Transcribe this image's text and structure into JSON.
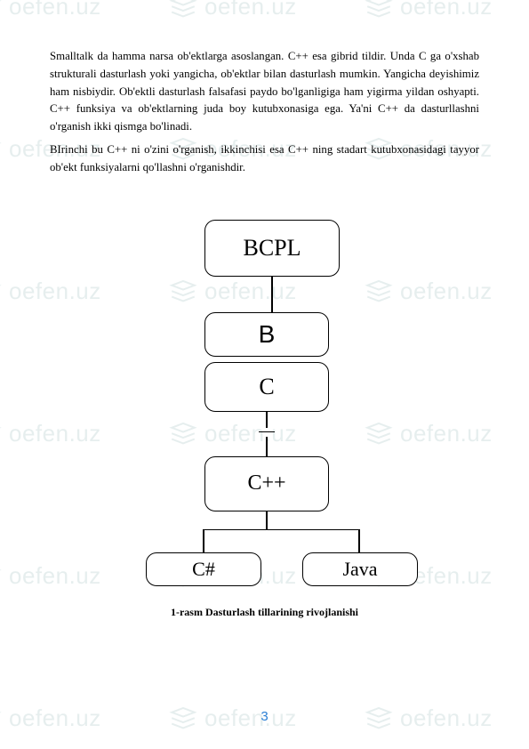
{
  "watermark": {
    "text": "oefen.uz"
  },
  "paragraphs": {
    "p1": "Smalltalk da hamma narsa ob'ektlarga asoslangan. C++ esa gibrid tildir. Unda C ga o'xshab strukturali dasturlash yoki yangicha, ob'ektlar bilan dasturlash mumkin. Yangicha deyishimiz ham nisbiydir. Ob'ektli dasturlash falsafasi paydo bo'lganligiga ham yigirma yildan oshyapti. C++  funksiya va ob'ektlarning juda boy kutubxonasiga ega. Ya'ni C++ da dasturllashni o'rganish ikki qismga bo'linadi.",
    "p2": "BIrinchi bu C++ ni o'zini o'rganish, ikkinchisi esa C++ ning stadart kutubxonasidagi tayyor ob'ekt funksiyalarni qo'llashni o'rganishdir."
  },
  "diagram": {
    "bcpl": "BCPL",
    "b": "B",
    "c": "C",
    "cpp": "C++",
    "csharp": "C#",
    "java": "Java"
  },
  "caption": "1-rasm Dasturlash tillarining rivojlanishi",
  "pageNumber": "3"
}
